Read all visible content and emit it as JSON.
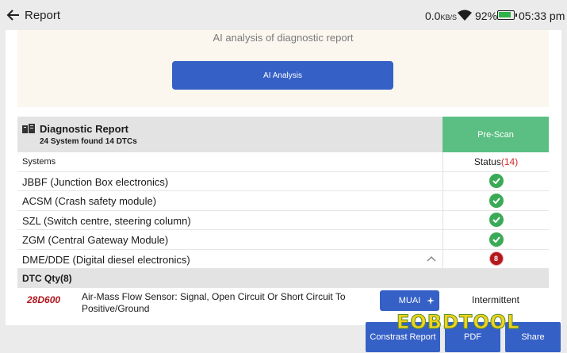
{
  "statusbar": {
    "title": "Report",
    "net_speed": "0.0",
    "net_unit": "KB/S",
    "battery": "92%",
    "time": "05:33 pm"
  },
  "ai": {
    "title": "AI analysis of diagnostic report",
    "button": "AI Analysis"
  },
  "report": {
    "title": "Diagnostic Report",
    "subtitle": "24 System found 14 DTCs",
    "prescan": "Pre-Scan",
    "col_systems": "Systems",
    "col_status": "Status",
    "status_count": "(14)",
    "systems": [
      {
        "name": "JBBF (Junction Box electronics)",
        "status": "ok"
      },
      {
        "name": "ACSM (Crash safety module)",
        "status": "ok"
      },
      {
        "name": "SZL (Switch centre, steering column)",
        "status": "ok"
      },
      {
        "name": "ZGM (Central Gateway Module)",
        "status": "ok"
      },
      {
        "name": "DME/DDE (Digital diesel electronics)",
        "status": "8"
      }
    ]
  },
  "dtc": {
    "header": "DTC Qty(8)",
    "rows": [
      {
        "code": "28D600",
        "desc": "Air-Mass Flow Sensor: Signal, Open Circuit Or Short Circuit To Positive/Ground",
        "button": "MUAI",
        "status": "Intermittent"
      }
    ]
  },
  "actions": {
    "compare": "Constrast Report",
    "pdf": "PDF",
    "share": "Share"
  },
  "watermark": "EOBDTOOL",
  "colors": {
    "accent_blue": "#3560c6",
    "prescan_green": "#5bbf83",
    "ok_green": "#3aaa56",
    "error_red": "#b3181c",
    "dtc_code_red": "#b0151d"
  }
}
